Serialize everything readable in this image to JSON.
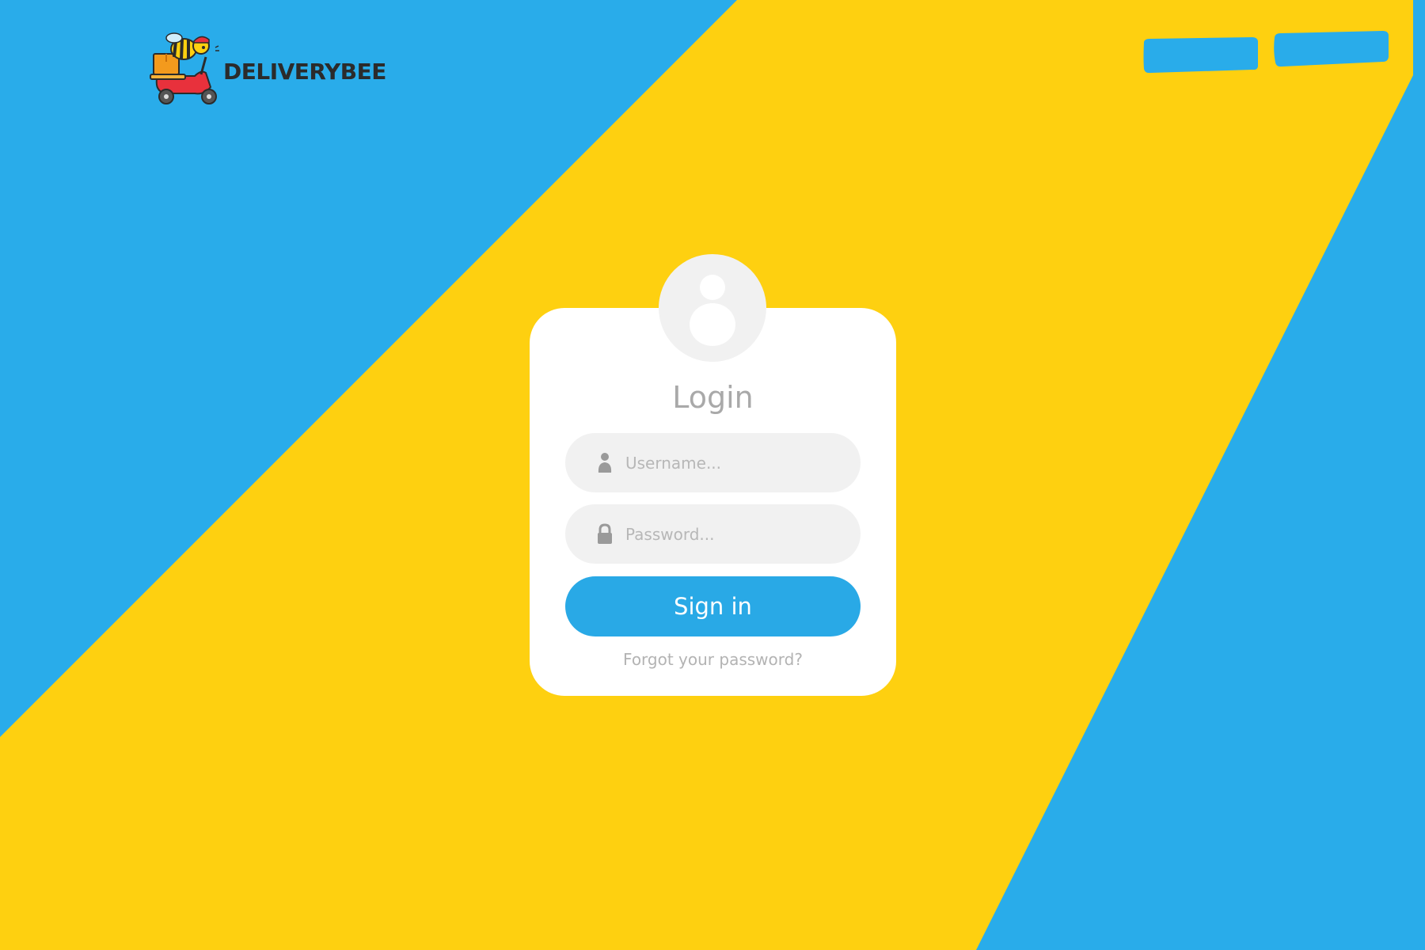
{
  "brand": {
    "name": "DELIVERYBEE",
    "logo_icon": "bee-on-scooter-icon"
  },
  "colors": {
    "blue": "#29ACEA",
    "yellow": "#FED010",
    "card": "#FFFFFF",
    "field_bg": "#F1F1F1",
    "button": "#29A9E6",
    "muted_text": "#A9A9A9"
  },
  "nav": {
    "buttons": [
      {
        "label": "",
        "icon": "brush-stroke-button"
      },
      {
        "label": "",
        "icon": "brush-stroke-button"
      }
    ]
  },
  "login": {
    "avatar_icon": "user-icon",
    "title": "Login",
    "username": {
      "placeholder": "Username...",
      "value": "",
      "icon": "user-icon"
    },
    "password": {
      "placeholder": "Password...",
      "value": "",
      "icon": "lock-icon"
    },
    "submit_label": "Sign in",
    "forgot_link": "Forgot your password?"
  }
}
